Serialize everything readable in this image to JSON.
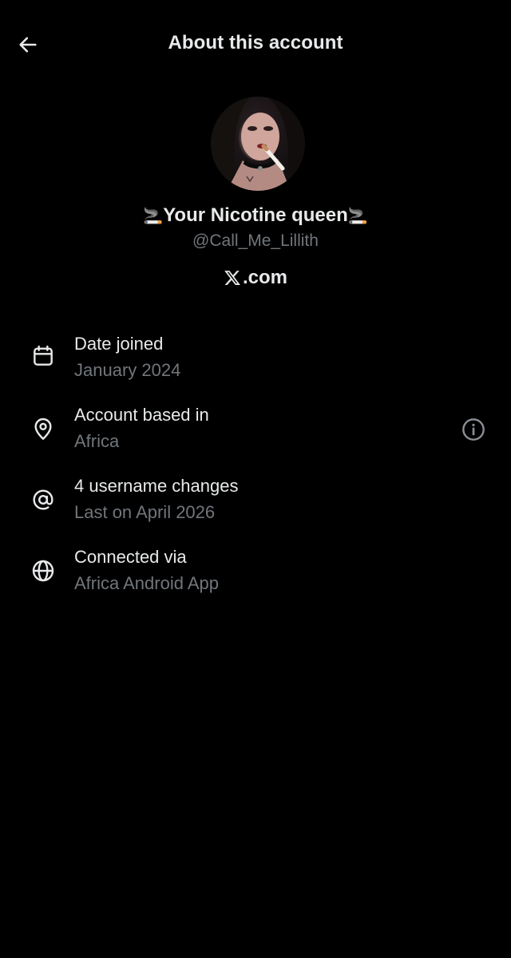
{
  "header": {
    "title": "About this account",
    "back_icon": "arrow-left-icon"
  },
  "profile": {
    "emoji_left": "🚬",
    "name": "Your Nicotine queen",
    "emoji_right": "🚬",
    "handle": "@Call_Me_Lillith",
    "site_logo": "x-logo",
    "site_text": ".com"
  },
  "details": [
    {
      "icon": "calendar-icon",
      "title": "Date joined",
      "value": "January 2024"
    },
    {
      "icon": "location-pin-icon",
      "title": "Account based in",
      "value": "Africa",
      "info_icon": "info-circle-icon"
    },
    {
      "icon": "at-sign-icon",
      "title": "4 username changes",
      "value": "Last on April 2026"
    },
    {
      "icon": "globe-icon",
      "title": "Connected via",
      "value": "Africa Android App"
    }
  ],
  "colors": {
    "background": "#000000",
    "primary_text": "#e7e9ea",
    "secondary_text": "#71767b"
  }
}
